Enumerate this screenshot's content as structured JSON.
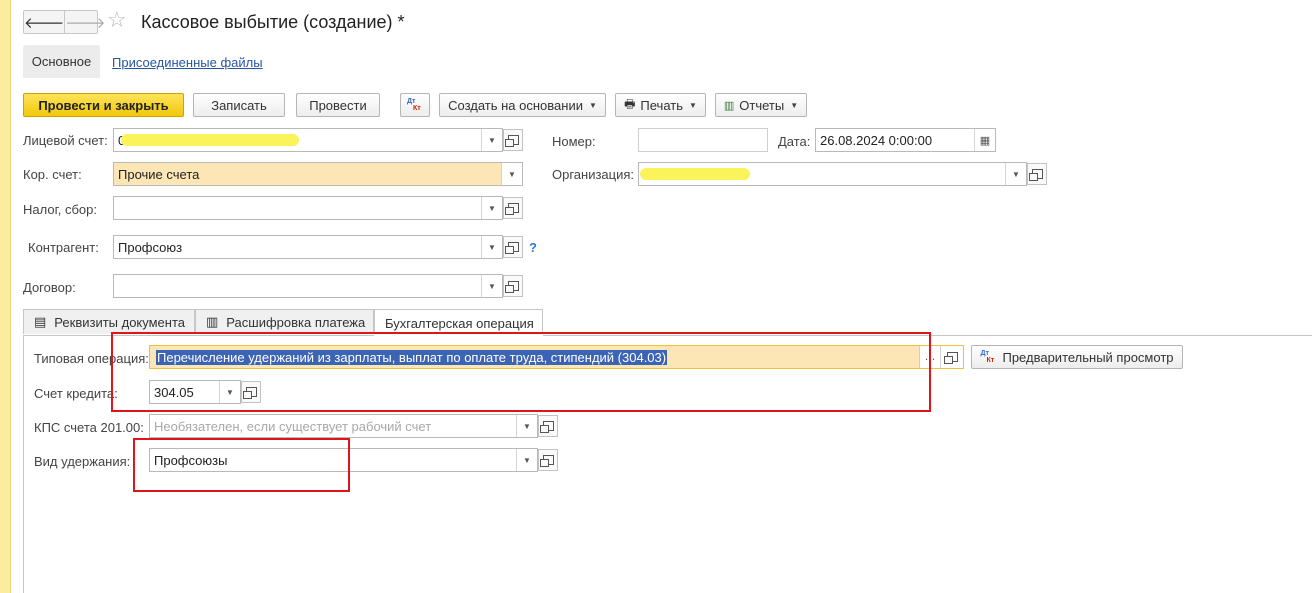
{
  "nav": {
    "back": "🡐",
    "forward": "🡒"
  },
  "window": {
    "title": "Кассовое выбытие (создание) *"
  },
  "tabs": {
    "main": "Основное",
    "files": "Присоединенные файлы"
  },
  "toolbar": {
    "post_close": "Провести и закрыть",
    "save": "Записать",
    "post": "Провести",
    "create_based": "Создать на основании",
    "print": "Печать",
    "reports": "Отчеты",
    "dt": "Дт",
    "kt": "Кт"
  },
  "form": {
    "account_label": "Лицевой счет:",
    "account_value": "0",
    "korr_label": "Кор. счет:",
    "korr_value": "Прочие счета",
    "tax_label": "Налог, сбор:",
    "tax_value": "",
    "counterparty_label": "Контрагент:",
    "counterparty_value": "Профсоюз",
    "contract_label": "Договор:",
    "contract_value": "",
    "number_label": "Номер:",
    "number_value": "",
    "date_label": "Дата:",
    "date_value": "26.08.2024  0:00:00",
    "org_label": "Организация:",
    "org_value": "",
    "help": "?"
  },
  "subtabs": {
    "requisites": "Реквизиты документа",
    "payment": "Расшифровка платежа",
    "accounting": "Бухгалтерская операция"
  },
  "operation": {
    "typical_label": "Типовая операция:",
    "typical_value": "Перечисление удержаний из зарплаты, выплат по оплате труда, стипендий (304.03)",
    "preview_button": "Предварительный просмотр",
    "credit_label": "Счет кредита:",
    "credit_value": "304.05",
    "kps_label": "КПС счета 201.00:",
    "kps_placeholder": "Необязателен, если существует рабочий счет",
    "deduction_label": "Вид удержания:",
    "deduction_value": "Профсоюзы"
  },
  "colors": {
    "accent": "#f1c80a",
    "highlight_box": "#e0141b",
    "field_fill": "#fde6b6"
  }
}
